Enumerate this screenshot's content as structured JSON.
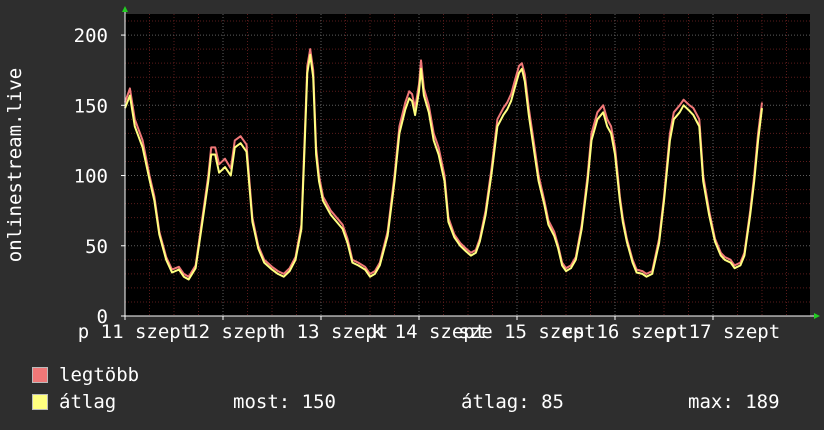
{
  "chart_data": {
    "type": "line",
    "ylabel": "onlinestream.live",
    "ylim": [
      0,
      215
    ],
    "yticks": [
      0,
      50,
      100,
      150,
      200
    ],
    "xticks": [
      {
        "label": "p 11 szept",
        "pos": 0.0
      },
      {
        "label": "12 szept",
        "pos": 1.0
      },
      {
        "label": "h 13 szept",
        "pos": 2.0
      },
      {
        "label": "k 14 szept",
        "pos": 3.0
      },
      {
        "label": "sze 15 szept",
        "pos": 4.0
      },
      {
        "label": "cs 16 szept",
        "pos": 5.0
      },
      {
        "label": "p 17 szept",
        "pos": 6.0
      }
    ],
    "x_unit": "days since 11 szept 00:00",
    "grid": true,
    "colors": {
      "background": "#2e2e2e",
      "plot_bg": "#000000",
      "grid_minor": "#5a1b1b",
      "grid_major": "#5e5e5e",
      "axis": "#ffffff",
      "arrow": "#22cc22",
      "max_line": "#f07878",
      "avg_line": "#ffff80"
    },
    "series": [
      {
        "name": "legtöbb",
        "color": "#f07878",
        "points": [
          [
            0.0,
            152
          ],
          [
            0.05,
            162
          ],
          [
            0.1,
            140
          ],
          [
            0.18,
            125
          ],
          [
            0.25,
            100
          ],
          [
            0.3,
            85
          ],
          [
            0.35,
            60
          ],
          [
            0.42,
            42
          ],
          [
            0.48,
            33
          ],
          [
            0.55,
            35
          ],
          [
            0.6,
            30
          ],
          [
            0.65,
            28
          ],
          [
            0.72,
            36
          ],
          [
            0.78,
            65
          ],
          [
            0.85,
            100
          ],
          [
            0.88,
            120
          ],
          [
            0.92,
            120
          ],
          [
            0.96,
            108
          ],
          [
            1.02,
            112
          ],
          [
            1.08,
            105
          ],
          [
            1.12,
            125
          ],
          [
            1.18,
            128
          ],
          [
            1.24,
            122
          ],
          [
            1.3,
            70
          ],
          [
            1.36,
            50
          ],
          [
            1.42,
            40
          ],
          [
            1.5,
            35
          ],
          [
            1.56,
            32
          ],
          [
            1.62,
            30
          ],
          [
            1.68,
            34
          ],
          [
            1.74,
            42
          ],
          [
            1.8,
            65
          ],
          [
            1.83,
            120
          ],
          [
            1.86,
            178
          ],
          [
            1.89,
            190
          ],
          [
            1.92,
            175
          ],
          [
            1.95,
            120
          ],
          [
            1.98,
            100
          ],
          [
            2.02,
            85
          ],
          [
            2.1,
            75
          ],
          [
            2.16,
            70
          ],
          [
            2.22,
            65
          ],
          [
            2.27,
            55
          ],
          [
            2.32,
            40
          ],
          [
            2.38,
            38
          ],
          [
            2.45,
            35
          ],
          [
            2.5,
            30
          ],
          [
            2.55,
            32
          ],
          [
            2.6,
            38
          ],
          [
            2.68,
            60
          ],
          [
            2.75,
            100
          ],
          [
            2.8,
            135
          ],
          [
            2.86,
            152
          ],
          [
            2.9,
            160
          ],
          [
            2.93,
            158
          ],
          [
            2.96,
            148
          ],
          [
            3.0,
            165
          ],
          [
            3.02,
            182
          ],
          [
            3.05,
            162
          ],
          [
            3.1,
            150
          ],
          [
            3.15,
            130
          ],
          [
            3.2,
            120
          ],
          [
            3.26,
            100
          ],
          [
            3.3,
            70
          ],
          [
            3.36,
            58
          ],
          [
            3.42,
            52
          ],
          [
            3.48,
            48
          ],
          [
            3.53,
            45
          ],
          [
            3.58,
            47
          ],
          [
            3.62,
            55
          ],
          [
            3.68,
            75
          ],
          [
            3.74,
            105
          ],
          [
            3.8,
            140
          ],
          [
            3.86,
            148
          ],
          [
            3.9,
            152
          ],
          [
            3.94,
            158
          ],
          [
            3.98,
            168
          ],
          [
            4.02,
            178
          ],
          [
            4.05,
            180
          ],
          [
            4.08,
            172
          ],
          [
            4.12,
            148
          ],
          [
            4.18,
            120
          ],
          [
            4.22,
            100
          ],
          [
            4.28,
            82
          ],
          [
            4.32,
            68
          ],
          [
            4.38,
            60
          ],
          [
            4.42,
            50
          ],
          [
            4.46,
            38
          ],
          [
            4.5,
            34
          ],
          [
            4.55,
            36
          ],
          [
            4.6,
            42
          ],
          [
            4.66,
            65
          ],
          [
            4.72,
            100
          ],
          [
            4.76,
            130
          ],
          [
            4.82,
            145
          ],
          [
            4.88,
            150
          ],
          [
            4.92,
            140
          ],
          [
            4.96,
            135
          ],
          [
            5.0,
            120
          ],
          [
            5.05,
            85
          ],
          [
            5.08,
            70
          ],
          [
            5.12,
            55
          ],
          [
            5.18,
            40
          ],
          [
            5.22,
            33
          ],
          [
            5.28,
            32
          ],
          [
            5.32,
            30
          ],
          [
            5.38,
            32
          ],
          [
            5.45,
            55
          ],
          [
            5.5,
            85
          ],
          [
            5.56,
            130
          ],
          [
            5.6,
            145
          ],
          [
            5.66,
            150
          ],
          [
            5.7,
            154
          ],
          [
            5.76,
            150
          ],
          [
            5.8,
            148
          ],
          [
            5.86,
            140
          ],
          [
            5.9,
            100
          ],
          [
            5.96,
            75
          ],
          [
            6.02,
            55
          ],
          [
            6.08,
            45
          ],
          [
            6.12,
            42
          ],
          [
            6.18,
            40
          ],
          [
            6.22,
            36
          ],
          [
            6.28,
            38
          ],
          [
            6.32,
            45
          ],
          [
            6.38,
            75
          ],
          [
            6.42,
            100
          ],
          [
            6.46,
            130
          ],
          [
            6.5,
            152
          ]
        ]
      },
      {
        "name": "átlag",
        "color": "#ffff80",
        "points": [
          [
            0.0,
            148
          ],
          [
            0.05,
            157
          ],
          [
            0.1,
            135
          ],
          [
            0.18,
            120
          ],
          [
            0.25,
            97
          ],
          [
            0.3,
            82
          ],
          [
            0.35,
            58
          ],
          [
            0.42,
            40
          ],
          [
            0.48,
            31
          ],
          [
            0.55,
            33
          ],
          [
            0.6,
            28
          ],
          [
            0.65,
            26
          ],
          [
            0.72,
            34
          ],
          [
            0.78,
            62
          ],
          [
            0.85,
            96
          ],
          [
            0.88,
            115
          ],
          [
            0.92,
            115
          ],
          [
            0.96,
            102
          ],
          [
            1.02,
            106
          ],
          [
            1.08,
            100
          ],
          [
            1.12,
            120
          ],
          [
            1.18,
            123
          ],
          [
            1.24,
            117
          ],
          [
            1.3,
            67
          ],
          [
            1.36,
            48
          ],
          [
            1.42,
            38
          ],
          [
            1.5,
            33
          ],
          [
            1.56,
            30
          ],
          [
            1.62,
            28
          ],
          [
            1.68,
            32
          ],
          [
            1.74,
            40
          ],
          [
            1.8,
            62
          ],
          [
            1.83,
            115
          ],
          [
            1.86,
            173
          ],
          [
            1.89,
            186
          ],
          [
            1.92,
            170
          ],
          [
            1.95,
            115
          ],
          [
            1.98,
            96
          ],
          [
            2.02,
            82
          ],
          [
            2.1,
            72
          ],
          [
            2.16,
            67
          ],
          [
            2.22,
            62
          ],
          [
            2.27,
            52
          ],
          [
            2.32,
            38
          ],
          [
            2.38,
            36
          ],
          [
            2.45,
            33
          ],
          [
            2.5,
            28
          ],
          [
            2.55,
            30
          ],
          [
            2.6,
            36
          ],
          [
            2.68,
            57
          ],
          [
            2.75,
            96
          ],
          [
            2.8,
            130
          ],
          [
            2.86,
            147
          ],
          [
            2.9,
            155
          ],
          [
            2.93,
            153
          ],
          [
            2.96,
            143
          ],
          [
            3.0,
            160
          ],
          [
            3.02,
            176
          ],
          [
            3.05,
            157
          ],
          [
            3.1,
            145
          ],
          [
            3.15,
            125
          ],
          [
            3.2,
            115
          ],
          [
            3.26,
            96
          ],
          [
            3.3,
            67
          ],
          [
            3.36,
            56
          ],
          [
            3.42,
            50
          ],
          [
            3.48,
            46
          ],
          [
            3.53,
            43
          ],
          [
            3.58,
            45
          ],
          [
            3.62,
            53
          ],
          [
            3.68,
            72
          ],
          [
            3.74,
            101
          ],
          [
            3.8,
            135
          ],
          [
            3.86,
            143
          ],
          [
            3.9,
            147
          ],
          [
            3.94,
            153
          ],
          [
            3.98,
            163
          ],
          [
            4.02,
            173
          ],
          [
            4.05,
            176
          ],
          [
            4.08,
            167
          ],
          [
            4.12,
            143
          ],
          [
            4.18,
            115
          ],
          [
            4.22,
            96
          ],
          [
            4.28,
            79
          ],
          [
            4.32,
            65
          ],
          [
            4.38,
            57
          ],
          [
            4.42,
            48
          ],
          [
            4.46,
            36
          ],
          [
            4.5,
            32
          ],
          [
            4.55,
            34
          ],
          [
            4.6,
            40
          ],
          [
            4.66,
            62
          ],
          [
            4.72,
            96
          ],
          [
            4.76,
            125
          ],
          [
            4.82,
            140
          ],
          [
            4.88,
            145
          ],
          [
            4.92,
            135
          ],
          [
            4.96,
            130
          ],
          [
            5.0,
            115
          ],
          [
            5.05,
            82
          ],
          [
            5.08,
            67
          ],
          [
            5.12,
            53
          ],
          [
            5.18,
            38
          ],
          [
            5.22,
            31
          ],
          [
            5.28,
            30
          ],
          [
            5.32,
            28
          ],
          [
            5.38,
            30
          ],
          [
            5.45,
            52
          ],
          [
            5.5,
            82
          ],
          [
            5.56,
            125
          ],
          [
            5.6,
            140
          ],
          [
            5.66,
            145
          ],
          [
            5.7,
            150
          ],
          [
            5.76,
            146
          ],
          [
            5.8,
            143
          ],
          [
            5.86,
            135
          ],
          [
            5.9,
            96
          ],
          [
            5.96,
            72
          ],
          [
            6.02,
            53
          ],
          [
            6.08,
            43
          ],
          [
            6.12,
            40
          ],
          [
            6.18,
            38
          ],
          [
            6.22,
            34
          ],
          [
            6.28,
            36
          ],
          [
            6.32,
            43
          ],
          [
            6.38,
            72
          ],
          [
            6.42,
            96
          ],
          [
            6.46,
            125
          ],
          [
            6.5,
            148
          ]
        ]
      }
    ]
  },
  "legend": {
    "max_label": "legtöbb",
    "avg_label": "átlag",
    "most": "most: 150",
    "avg": "átlag: 85",
    "max": "max: 189"
  }
}
